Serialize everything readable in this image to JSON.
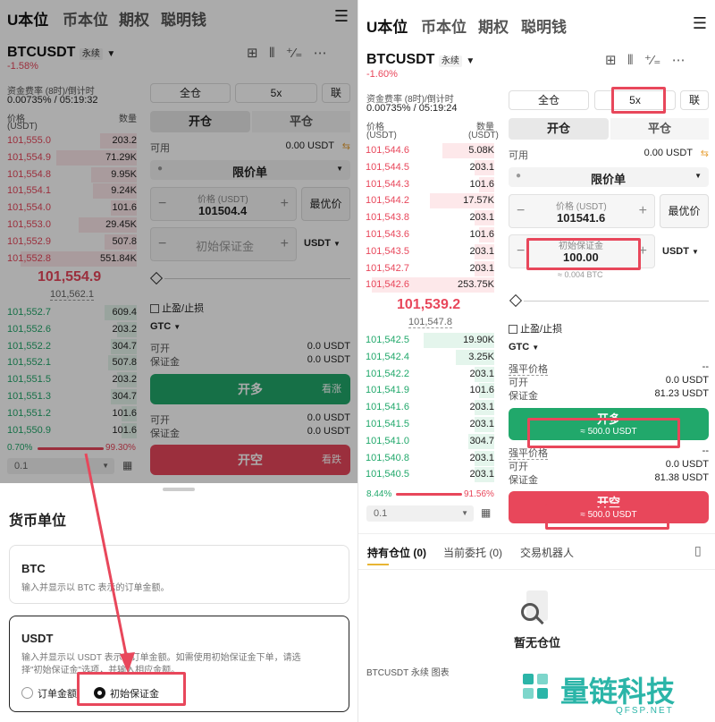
{
  "nav": {
    "tabs": [
      "U本位",
      "币本位",
      "期权",
      "聪明钱"
    ],
    "menu_icon": "hamburger-icon"
  },
  "left": {
    "symbol": "BTCUSDT",
    "perp": "永续",
    "change": "-1.58%",
    "funding_label": "资金费率 (8时)/倒计时",
    "funding_value": "0.00735% / 05:19:32",
    "price_header": "价格",
    "price_unit": "(USDT)",
    "qty_header": "数量",
    "asks": [
      {
        "p": "101,555.0",
        "q": "203.2",
        "depth": 0.28
      },
      {
        "p": "101,554.9",
        "q": "71.29K",
        "depth": 0.62
      },
      {
        "p": "101,554.8",
        "q": "9.95K",
        "depth": 0.35
      },
      {
        "p": "101,554.1",
        "q": "9.24K",
        "depth": 0.34
      },
      {
        "p": "101,554.0",
        "q": "101.6",
        "depth": 0.2
      },
      {
        "p": "101,553.0",
        "q": "29.45K",
        "depth": 0.45
      },
      {
        "p": "101,552.9",
        "q": "507.8",
        "depth": 0.25
      },
      {
        "p": "101,552.8",
        "q": "551.84K",
        "depth": 0.9
      }
    ],
    "last_price": "101,554.9",
    "mark_price": "101,562.1",
    "bids": [
      {
        "p": "101,552.7",
        "q": "609.4",
        "depth": 0.25
      },
      {
        "p": "101,552.6",
        "q": "203.2",
        "depth": 0.15
      },
      {
        "p": "101,552.2",
        "q": "304.7",
        "depth": 0.2
      },
      {
        "p": "101,552.1",
        "q": "507.8",
        "depth": 0.22
      },
      {
        "p": "101,551.5",
        "q": "203.2",
        "depth": 0.15
      },
      {
        "p": "101,551.3",
        "q": "304.7",
        "depth": 0.2
      },
      {
        "p": "101,551.2",
        "q": "101.6",
        "depth": 0.12
      },
      {
        "p": "101,550.9",
        "q": "101.6",
        "depth": 0.12
      }
    ],
    "ratio_bid": "0.70%",
    "ratio_ask": "99.30%",
    "precision": "0.1",
    "margin_mode": "全仓",
    "leverage": "5x",
    "joint": "联",
    "open_tab": "开仓",
    "close_tab": "平仓",
    "available_label": "可用",
    "available_value": "0.00 USDT",
    "order_type": "限价单",
    "price_field_label": "价格 (USDT)",
    "price_field_value": "101504.4",
    "best_price": "最优价",
    "margin_placeholder": "初始保证金",
    "unit": "USDT",
    "tp_sl": "止盈/止损",
    "tif": "GTC",
    "can_open": "可开",
    "can_open_value": "0.0 USDT",
    "margin_label": "保证金",
    "margin_value": "0.0 USDT",
    "long_btn": "开多",
    "long_side": "看涨",
    "can_open2_value": "0.0 USDT",
    "margin2_value": "0.0 USDT",
    "short_btn": "开空",
    "short_side": "看跌"
  },
  "sheet": {
    "title": "货币单位",
    "btc_title": "BTC",
    "btc_desc": "输入并显示以 BTC 表示的订单金额。",
    "usdt_title": "USDT",
    "usdt_desc1": "输入并显示以 USDT 表示的订单金额。如需使用初始保证金下单，请选",
    "usdt_desc2": "择\"初始保证金\"选项，并输入相应金额。",
    "opt_order_amount": "订单金额",
    "opt_initial_margin": "初始保证金"
  },
  "right": {
    "symbol": "BTCUSDT",
    "perp": "永续",
    "change": "-1.60%",
    "funding_label": "资金费率 (8时)/倒计时",
    "funding_value": "0.00735% / 05:19:24",
    "price_header": "价格",
    "price_unit": "(USDT)",
    "qty_header": "数量",
    "asks": [
      {
        "p": "101,544.6",
        "q": "5.08K",
        "depth": 0.4
      },
      {
        "p": "101,544.5",
        "q": "203.1",
        "depth": 0.15
      },
      {
        "p": "101,544.3",
        "q": "101.6",
        "depth": 0.12
      },
      {
        "p": "101,544.2",
        "q": "17.57K",
        "depth": 0.5
      },
      {
        "p": "101,543.8",
        "q": "203.1",
        "depth": 0.15
      },
      {
        "p": "101,543.6",
        "q": "101.6",
        "depth": 0.12
      },
      {
        "p": "101,543.5",
        "q": "203.1",
        "depth": 0.15
      },
      {
        "p": "101,542.7",
        "q": "203.1",
        "depth": 0.15
      },
      {
        "p": "101,542.6",
        "q": "253.75K",
        "depth": 0.95
      }
    ],
    "last_price": "101,539.2",
    "mark_price": "101,547.8",
    "bids": [
      {
        "p": "101,542.5",
        "q": "19.90K",
        "depth": 0.55
      },
      {
        "p": "101,542.4",
        "q": "3.25K",
        "depth": 0.3
      },
      {
        "p": "101,542.2",
        "q": "203.1",
        "depth": 0.15
      },
      {
        "p": "101,541.9",
        "q": "101.6",
        "depth": 0.12
      },
      {
        "p": "101,541.6",
        "q": "203.1",
        "depth": 0.15
      },
      {
        "p": "101,541.5",
        "q": "203.1",
        "depth": 0.15
      },
      {
        "p": "101,541.0",
        "q": "304.7",
        "depth": 0.2
      },
      {
        "p": "101,540.8",
        "q": "203.1",
        "depth": 0.15
      },
      {
        "p": "101,540.5",
        "q": "203.1",
        "depth": 0.15
      }
    ],
    "ratio_bid": "8.44%",
    "ratio_ask": "91.56%",
    "precision": "0.1",
    "margin_mode": "全仓",
    "leverage": "5x",
    "joint": "联",
    "open_tab": "开仓",
    "close_tab": "平仓",
    "available_label": "可用",
    "available_value": "0.00 USDT",
    "order_type": "限价单",
    "price_field_label": "价格 (USDT)",
    "price_field_value": "101541.6",
    "best_price": "最优价",
    "margin_field_label": "初始保证金",
    "margin_field_value": "100.00",
    "unit": "USDT",
    "btc_equiv": "≈ 0.004 BTC",
    "tp_sl": "止盈/止损",
    "tif": "GTC",
    "liq_label": "强平价格",
    "liq_value": "--",
    "can_open": "可开",
    "can_open_value": "0.0 USDT",
    "margin_label": "保证金",
    "margin_value": "81.23 USDT",
    "long_btn": "开多",
    "long_amount": "≈ 500.0 USDT",
    "liq2_value": "--",
    "can_open2_value": "0.0 USDT",
    "margin2_value": "81.38 USDT",
    "short_btn": "开空",
    "short_amount": "≈ 500.0 USDT",
    "bottom_tabs": [
      "持有仓位 (0)",
      "当前委托 (0)",
      "交易机器人"
    ],
    "empty_text": "暂无仓位",
    "bottom_partial": "BTCUSDT 永续  图表"
  },
  "watermark": {
    "name": "量链科技",
    "site": "QFSP.NET"
  },
  "colors": {
    "red": "#e8475b",
    "green": "#21a86b",
    "highlight": "#e8475b"
  }
}
